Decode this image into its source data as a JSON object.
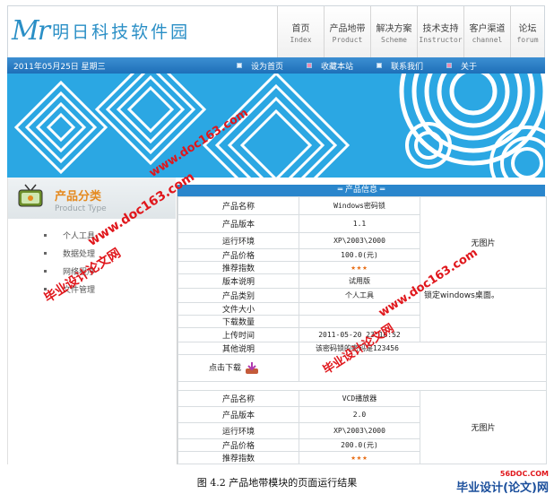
{
  "header": {
    "logo_mark": "Mr",
    "logo_text": "明日科技软件园"
  },
  "nav": [
    {
      "cn": "首页",
      "en": "Index"
    },
    {
      "cn": "产品地带",
      "en": "Product"
    },
    {
      "cn": "解决方案",
      "en": "Scheme"
    },
    {
      "cn": "技术支持",
      "en": "Instructor"
    },
    {
      "cn": "客户渠道",
      "en": "channel"
    },
    {
      "cn": "论坛",
      "en": "forum"
    }
  ],
  "bar": {
    "date": "2011年05月25日  星期三",
    "links": [
      "设为首页",
      "收藏本站",
      "联系我们",
      "关于"
    ]
  },
  "sidebar": {
    "title": "产品分类",
    "subtitle": "Product Type",
    "items": [
      "个人工具",
      "数据处理",
      "网络程序",
      "文件管理"
    ]
  },
  "main": {
    "heading": "═ 产品信息 ═",
    "products": [
      {
        "name_label": "产品名称",
        "name": "Windows密码锁",
        "version_label": "产品版本",
        "version": "1.1",
        "env_label": "运行环境",
        "env": "XP\\2003\\2000",
        "price_label": "产品价格",
        "price": "100.0(元)",
        "rating_label": "推荐指数",
        "rating": "★★★",
        "edition_label": "版本说明",
        "edition": "试用版",
        "category_label": "产品类别",
        "category": "个人工具",
        "size_label": "文件大小",
        "size": "",
        "downloads_label": "下载数量",
        "downloads": "",
        "upload_label": "上传时间",
        "upload": "2011-05-20 23:16:52",
        "other_label": "其他说明",
        "other": "该密码锁的密码是123456",
        "download_label": "点击下载",
        "image_text": "无图片",
        "description": "锁定windows桌面。"
      },
      {
        "name_label": "产品名称",
        "name": "VCD播放器",
        "version_label": "产品版本",
        "version": "2.0",
        "env_label": "运行环境",
        "env": "XP\\2003\\2000",
        "price_label": "产品价格",
        "price": "200.0(元)",
        "rating_label": "推荐指数",
        "rating": "★★★",
        "image_text": "无图片"
      }
    ]
  },
  "watermarks": [
    "www.doc163.com",
    "毕业设计论文网",
    "www.doc163.com",
    "毕业设计论文网",
    "www.doc163.com",
    "毕业设计论文网"
  ],
  "caption": "图 4.2   产品地带模块的页面运行结果",
  "footer_logo": {
    "line1": "56DOC.COM",
    "line2": "毕业设计(论文)网"
  },
  "colors": {
    "accent": "#2a86cc",
    "banner": "#2ba7e3",
    "watermark": "#e0161b",
    "orange": "#e58a1f"
  }
}
